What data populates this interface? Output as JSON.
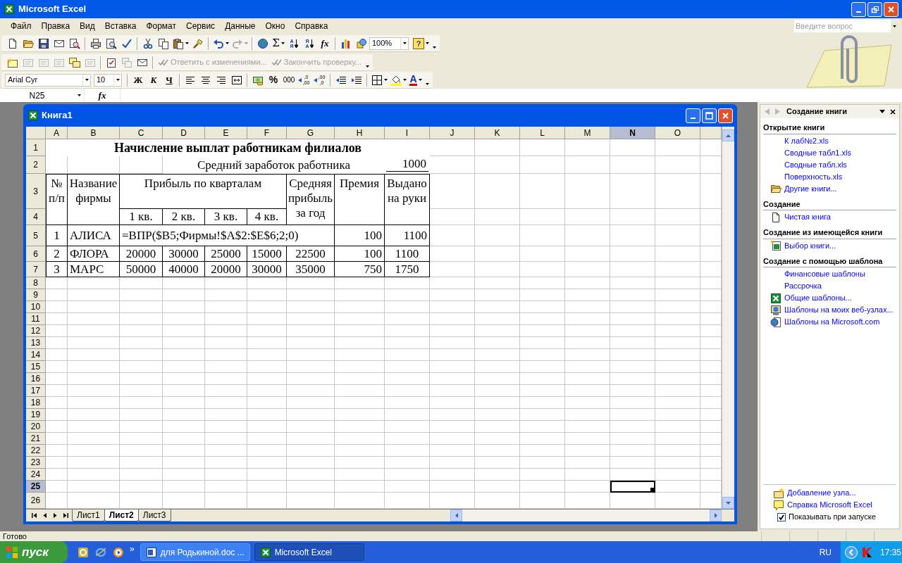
{
  "window": {
    "title": "Microsoft Excel"
  },
  "menu": [
    {
      "label": "Файл"
    },
    {
      "label": "Правка"
    },
    {
      "label": "Вид"
    },
    {
      "label": "Вставка"
    },
    {
      "label": "Формат"
    },
    {
      "label": "Сервис"
    },
    {
      "label": "Данные"
    },
    {
      "label": "Окно"
    },
    {
      "label": "Справка"
    }
  ],
  "ask_box": {
    "placeholder": "Введите вопрос"
  },
  "toolbars": [
    {
      "items": [
        {
          "kind": "new",
          "disabled": false
        },
        {
          "kind": "open",
          "disabled": false
        },
        {
          "kind": "save",
          "disabled": false
        },
        {
          "kind": "mail",
          "disabled": false
        },
        {
          "kind": "search",
          "disabled": false
        },
        {
          "kind": "sep"
        },
        {
          "kind": "print",
          "disabled": false
        },
        {
          "kind": "preview",
          "disabled": false
        },
        {
          "kind": "spell",
          "disabled": false
        },
        {
          "kind": "sep"
        },
        {
          "kind": "cut",
          "disabled": false
        },
        {
          "kind": "copy",
          "disabled": false
        },
        {
          "kind": "paste",
          "disabled": false,
          "dropdown": true
        },
        {
          "kind": "painter",
          "disabled": false
        },
        {
          "kind": "sep"
        },
        {
          "kind": "undo",
          "disabled": false,
          "dropdown": true
        },
        {
          "kind": "redo",
          "disabled": true,
          "dropdown": true
        },
        {
          "kind": "sep"
        },
        {
          "kind": "link",
          "disabled": false
        },
        {
          "kind": "autosum",
          "label": "Σ",
          "disabled": false,
          "dropdown": true
        },
        {
          "kind": "sort-asc",
          "label": "АЯ",
          "disabled": false
        },
        {
          "kind": "sort-desc",
          "label": "ЯА",
          "disabled": false
        },
        {
          "kind": "function",
          "label": "fx",
          "disabled": false
        },
        {
          "kind": "sep"
        },
        {
          "kind": "chart",
          "disabled": false
        },
        {
          "kind": "drawing",
          "disabled": false
        },
        {
          "kind": "zoom-combo",
          "value": "100%"
        },
        {
          "kind": "help",
          "label": "?",
          "disabled": false,
          "dropdown": true
        },
        {
          "kind": "overflow"
        }
      ]
    },
    {
      "items": [
        {
          "kind": "note-new",
          "disabled": false
        },
        {
          "kind": "note-prev",
          "disabled": true
        },
        {
          "kind": "note-next",
          "disabled": true
        },
        {
          "kind": "note-toggle",
          "disabled": true
        },
        {
          "kind": "note-all",
          "disabled": false
        },
        {
          "kind": "note-delete",
          "disabled": true
        },
        {
          "kind": "sep"
        },
        {
          "kind": "track",
          "disabled": false
        },
        {
          "kind": "protect",
          "disabled": true
        },
        {
          "kind": "send",
          "disabled": false
        },
        {
          "kind": "sep"
        },
        {
          "kind": "text",
          "label": "Ответить с изменениями...",
          "disabled": true
        },
        {
          "kind": "text",
          "label": "Закончить проверку...",
          "disabled": true
        },
        {
          "kind": "overflow"
        }
      ]
    },
    {
      "items": [
        {
          "kind": "font-combo",
          "value": "Arial Cyr"
        },
        {
          "kind": "size-combo",
          "value": "10"
        },
        {
          "kind": "sep"
        },
        {
          "kind": "bold",
          "label": "Ж",
          "disabled": false
        },
        {
          "kind": "italic",
          "label": "К",
          "disabled": false
        },
        {
          "kind": "underline",
          "label": "Ч",
          "disabled": false
        },
        {
          "kind": "sep"
        },
        {
          "kind": "align-left",
          "disabled": false
        },
        {
          "kind": "align-center",
          "disabled": false
        },
        {
          "kind": "align-right",
          "disabled": false
        },
        {
          "kind": "merge",
          "disabled": false
        },
        {
          "kind": "sep"
        },
        {
          "kind": "currency",
          "disabled": false
        },
        {
          "kind": "percent",
          "label": "%",
          "disabled": false
        },
        {
          "kind": "thousands",
          "label": "000",
          "disabled": false
        },
        {
          "kind": "dec-more",
          "label": ",0 ,00",
          "disabled": false
        },
        {
          "kind": "dec-less",
          "label": ",00 ,0",
          "disabled": false
        },
        {
          "kind": "sep"
        },
        {
          "kind": "outdent",
          "disabled": false
        },
        {
          "kind": "indent",
          "disabled": false
        },
        {
          "kind": "sep"
        },
        {
          "kind": "borders",
          "disabled": false,
          "dropdown": true
        },
        {
          "kind": "fill",
          "disabled": false,
          "dropdown": true
        },
        {
          "kind": "font-color",
          "label": "A",
          "disabled": false,
          "dropdown": true
        },
        {
          "kind": "overflow"
        }
      ]
    }
  ],
  "formula_bar": {
    "name_box": "N25",
    "function_label": "fx"
  },
  "workbook": {
    "title": "Книга1",
    "sheets": [
      {
        "label": "Лист1",
        "selected": false
      },
      {
        "label": "Лист2",
        "selected": true
      },
      {
        "label": "Лист3",
        "selected": false
      }
    ]
  },
  "sheet": {
    "columns": [
      {
        "label": "A",
        "selected": false
      },
      {
        "label": "B",
        "selected": false
      },
      {
        "label": "C",
        "selected": false
      },
      {
        "label": "D",
        "selected": false
      },
      {
        "label": "E",
        "selected": false
      },
      {
        "label": "F",
        "selected": false
      },
      {
        "label": "G",
        "selected": false
      },
      {
        "label": "H",
        "selected": false
      },
      {
        "label": "I",
        "selected": false
      },
      {
        "label": "J",
        "selected": false
      },
      {
        "label": "K",
        "selected": false
      },
      {
        "label": "L",
        "selected": false
      },
      {
        "label": "M",
        "selected": false
      },
      {
        "label": "N",
        "selected": true
      },
      {
        "label": "O",
        "selected": false
      }
    ],
    "rows": [
      {
        "label": "1",
        "selected": false
      },
      {
        "label": "2",
        "selected": false
      },
      {
        "label": "3",
        "selected": false
      },
      {
        "label": "4",
        "selected": false
      },
      {
        "label": "5",
        "selected": false
      },
      {
        "label": "6",
        "selected": false
      },
      {
        "label": "7",
        "selected": false
      },
      {
        "label": "8",
        "selected": false
      },
      {
        "label": "9",
        "selected": false
      },
      {
        "label": "10",
        "selected": false
      },
      {
        "label": "11",
        "selected": false
      },
      {
        "label": "12",
        "selected": false
      },
      {
        "label": "13",
        "selected": false
      },
      {
        "label": "14",
        "selected": false
      },
      {
        "label": "15",
        "selected": false
      },
      {
        "label": "16",
        "selected": false
      },
      {
        "label": "17",
        "selected": false
      },
      {
        "label": "18",
        "selected": false
      },
      {
        "label": "19",
        "selected": false
      },
      {
        "label": "20",
        "selected": false
      },
      {
        "label": "21",
        "selected": false
      },
      {
        "label": "22",
        "selected": false
      },
      {
        "label": "23",
        "selected": false
      },
      {
        "label": "24",
        "selected": false
      },
      {
        "label": "25",
        "selected": true
      },
      {
        "label": "26",
        "selected": false
      }
    ],
    "cells": [
      "Начисление выплат работникам филиалов",
      "Средний заработок работника",
      "1000",
      "№ п/п",
      "Название фирмы",
      "Прибыль по кварталам",
      "Средняя прибыль за год",
      "Премия",
      "Выдано на руки",
      "1 кв.",
      "2 кв.",
      "3 кв.",
      "4 кв.",
      "1",
      "АЛИСА",
      "=ВПР($B5;Фирмы!$A$2:$E$6;2;0)",
      "100",
      "1100",
      "2",
      "ФЛОРА",
      "20000",
      "30000",
      "25000",
      "15000",
      "22500",
      "100",
      "1100",
      "3",
      "МАРС",
      "50000",
      "40000",
      "20000",
      "30000",
      "35000",
      "750",
      "1750"
    ]
  },
  "task_pane": {
    "title": "Создание книги",
    "sections": [
      {
        "heading": "Открытие книги",
        "links": [
          {
            "label": "К лаб№2.xls",
            "kind": "file"
          },
          {
            "label": "Сводные табл1.xls",
            "kind": "file"
          },
          {
            "label": "Сводные табл.xls",
            "kind": "file"
          },
          {
            "label": "Поверхность.xls",
            "kind": "file"
          },
          {
            "label": "Другие книги...",
            "kind": "folder"
          }
        ]
      },
      {
        "heading": "Создание",
        "links": [
          {
            "label": "Чистая книга",
            "kind": "blank"
          }
        ]
      },
      {
        "heading": "Создание из имеющейся книги",
        "links": [
          {
            "label": "Выбор книги...",
            "kind": "existing"
          }
        ]
      },
      {
        "heading": "Создание с помощью шаблона",
        "links": [
          {
            "label": "Финансовые шаблоны",
            "kind": "file"
          },
          {
            "label": "Рассрочка",
            "kind": "file"
          },
          {
            "label": "Общие шаблоны...",
            "kind": "excel"
          },
          {
            "label": "Шаблоны на моих веб-узлах...",
            "kind": "web"
          },
          {
            "label": "Шаблоны на Microsoft.com",
            "kind": "online"
          }
        ]
      }
    ],
    "footer_links": [
      {
        "label": "Добавление узла...",
        "kind": "add-place"
      },
      {
        "label": "Справка Microsoft Excel",
        "kind": "help"
      }
    ],
    "show_at_startup": {
      "label": "Показывать при запуске",
      "checked": true
    }
  },
  "status_bar": {
    "text": "Готово"
  },
  "taskbar": {
    "start": {
      "label": "пуск"
    },
    "quick_launch_more": "»",
    "tasks": [
      {
        "label": "для Родькиной.doc ...",
        "kind": "document",
        "selected": false
      },
      {
        "label": "Microsoft Excel",
        "kind": "spreadsheet",
        "selected": true
      }
    ],
    "language": "RU",
    "time": "17:35"
  }
}
